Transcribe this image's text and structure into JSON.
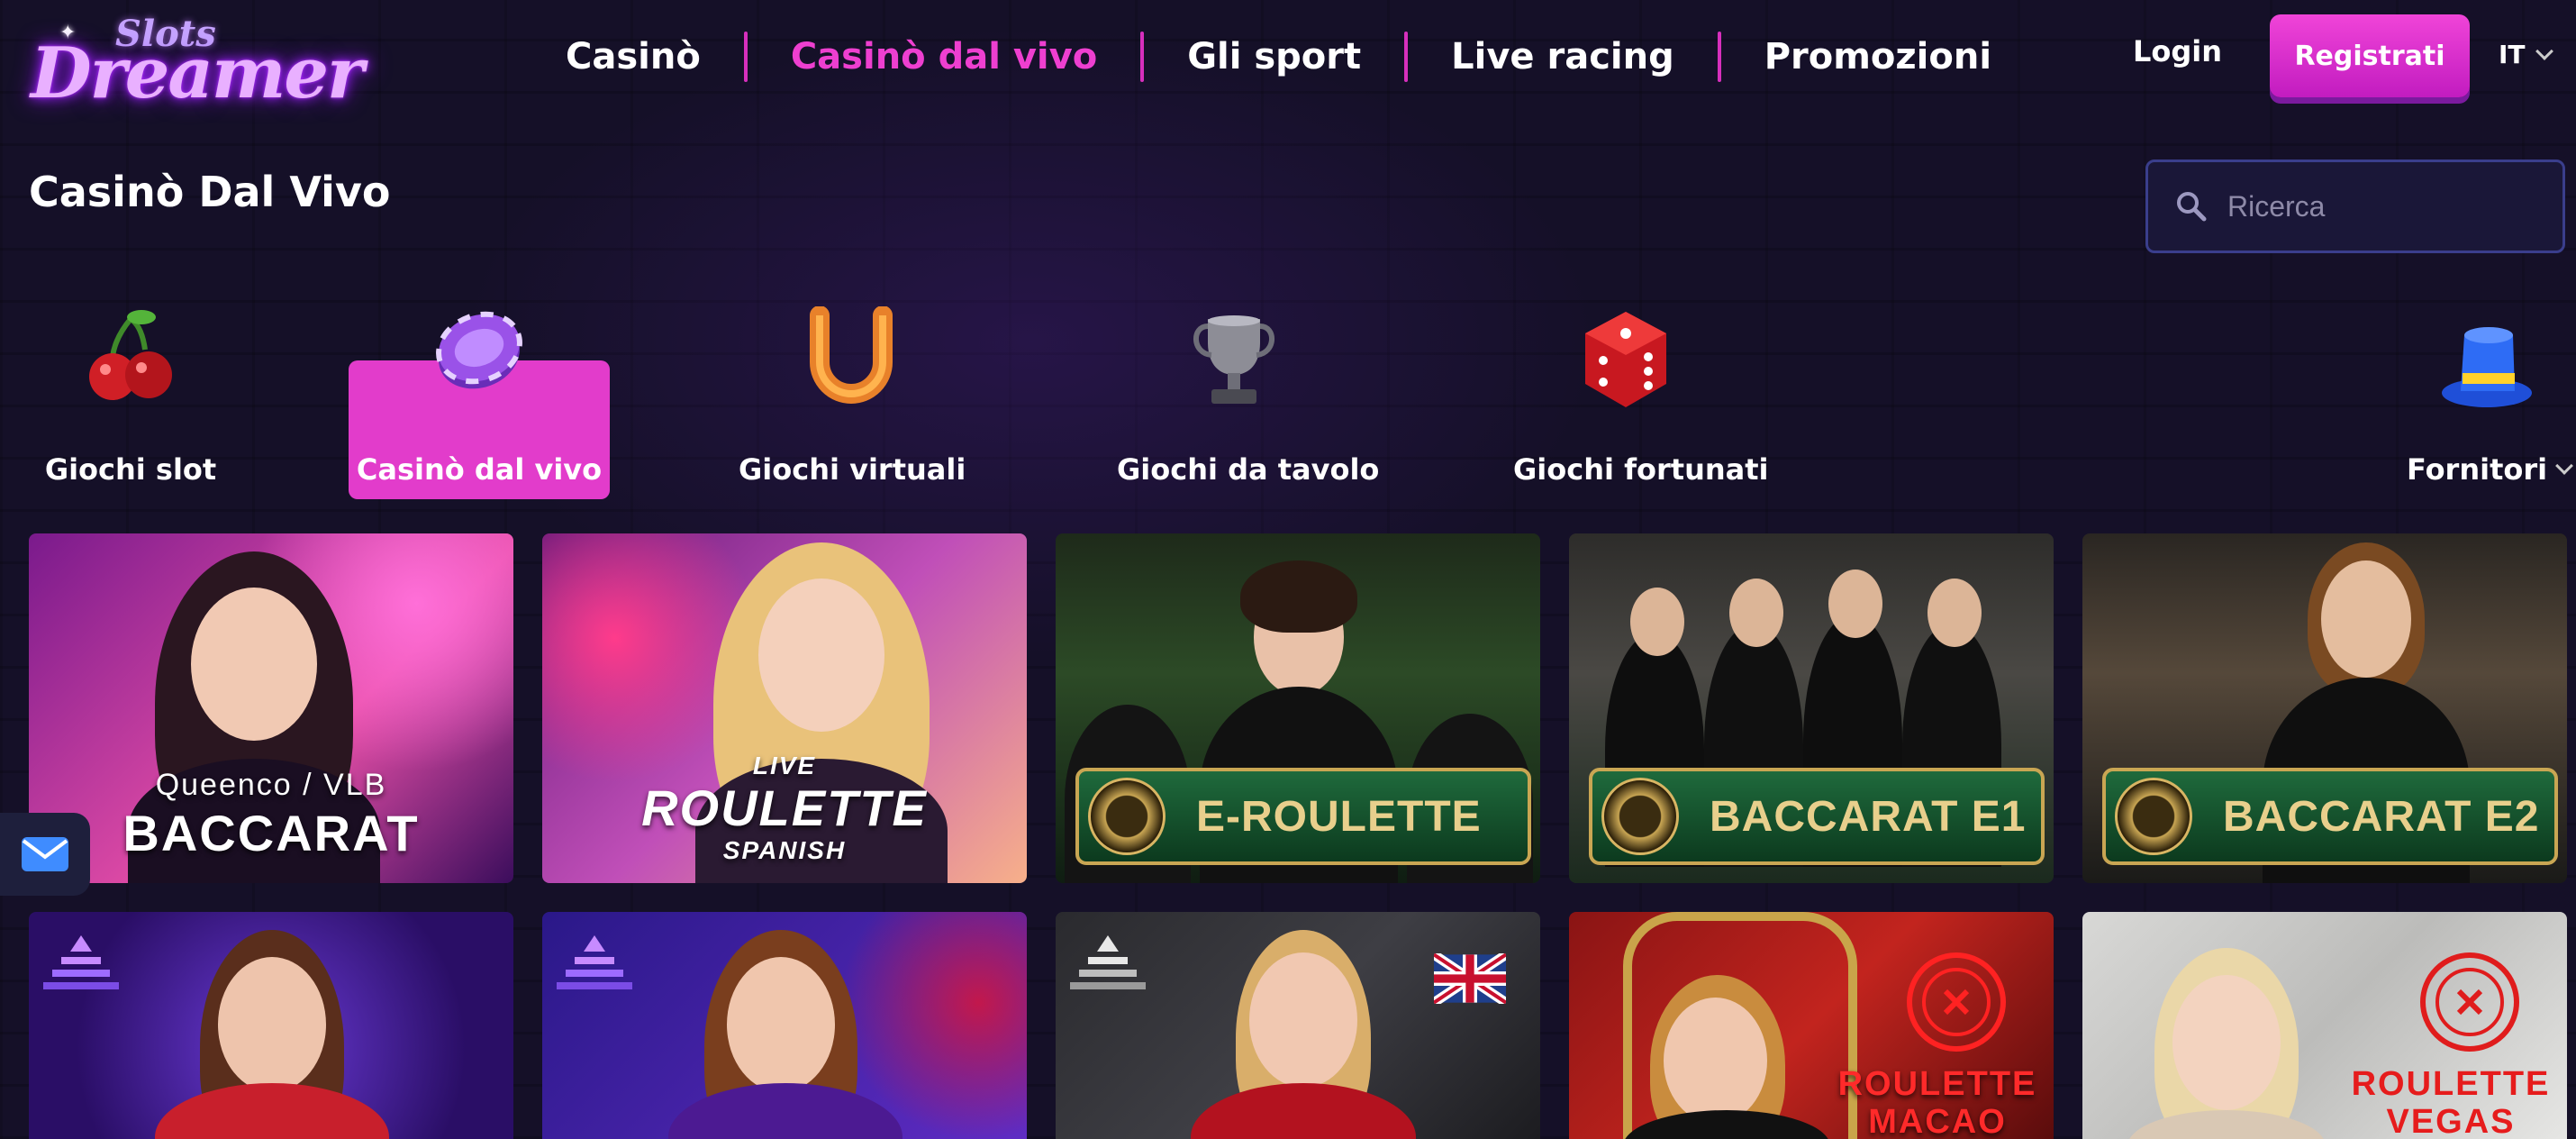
{
  "brand": {
    "logo_small": "Slots",
    "logo_big": "Dreamer"
  },
  "nav": {
    "items": [
      {
        "label": "Casinò",
        "active": false
      },
      {
        "label": "Casinò dal vivo",
        "active": true
      },
      {
        "label": "Gli sport",
        "active": false
      },
      {
        "label": "Live racing",
        "active": false
      },
      {
        "label": "Promozioni",
        "active": false
      }
    ],
    "login": "Login",
    "register": "Registrati",
    "language": "IT"
  },
  "page": {
    "title": "Casinò Dal Vivo"
  },
  "search": {
    "placeholder": "Ricerca",
    "value": ""
  },
  "categories": [
    {
      "label": "Giochi slot",
      "icon": "cherry-icon",
      "active": false
    },
    {
      "label": "Casinò dal vivo",
      "icon": "casino-chip-icon",
      "active": true
    },
    {
      "label": "Giochi virtuali",
      "icon": "horseshoe-icon",
      "active": false
    },
    {
      "label": "Giochi da tavolo",
      "icon": "trophy-icon",
      "active": false
    },
    {
      "label": "Giochi fortunati",
      "icon": "dice-icon",
      "active": false
    }
  ],
  "providers": {
    "label": "Fornitori",
    "icon": "top-hat-icon"
  },
  "games": [
    {
      "title_top": "Queenco / VLB",
      "title": "BACCARAT"
    },
    {
      "title_top": "LIVE",
      "title": "ROULETTE",
      "title_sub": "SPANISH"
    },
    {
      "title": "E-ROULETTE"
    },
    {
      "title": "BACCARAT E1"
    },
    {
      "title": "BACCARAT E2"
    },
    {
      "title": ""
    },
    {
      "title": ""
    },
    {
      "title": ""
    },
    {
      "title": "ROULETTE",
      "title_sub": "MACAO"
    },
    {
      "title": "ROULETTE",
      "title_sub": "VEGAS"
    }
  ],
  "colors": {
    "accent": "#e23ccb",
    "background": "#151028",
    "nav_separator": "#d72fbd"
  }
}
